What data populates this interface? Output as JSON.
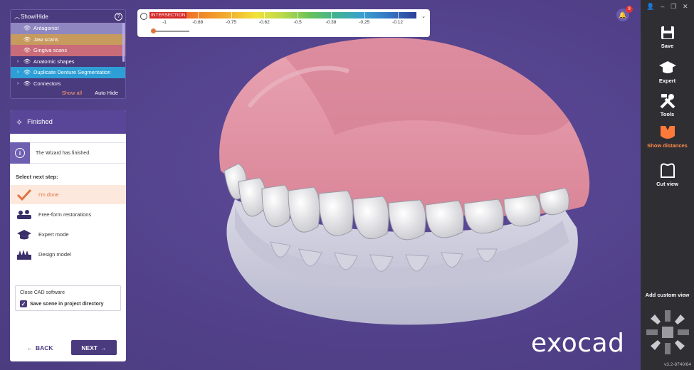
{
  "visibility": {
    "header": "Show/Hide",
    "rows": [
      {
        "name": "Antagonist",
        "color": "#8f87c0",
        "expandable": false
      },
      {
        "name": "Jaw scans",
        "color": "#c79a5e",
        "expandable": false
      },
      {
        "name": "Gingiva scans",
        "color": "#c96b78",
        "expandable": false
      },
      {
        "name": "Anatomic shapes",
        "color": "#4a3a7e",
        "expandable": true
      },
      {
        "name": "Duplicate Denture Segmentation",
        "color": "#2e9fd6",
        "expandable": true
      },
      {
        "name": "Connectors",
        "color": "#4a3a7e",
        "expandable": true
      }
    ],
    "show_all": "Show all",
    "auto_hide": "Auto Hide"
  },
  "wizard": {
    "title": "Finished",
    "message": "The Wizard has finished.",
    "next_step_label": "Select next step:",
    "options": [
      {
        "name": "I'm done",
        "selected": true
      },
      {
        "name": "Free-form restorations",
        "selected": false
      },
      {
        "name": "Expert mode",
        "selected": false
      },
      {
        "name": "Design model",
        "selected": false
      }
    ],
    "close_title": "Close CAD software",
    "save_scene": "Save scene in project directory",
    "back": "BACK",
    "next": "NEXT"
  },
  "scale": {
    "intersection": "INTERSECTION",
    "labels": [
      "-1",
      "-0.88",
      "-0.75",
      "-0.62",
      "-0.5",
      "-0.38",
      "-0.25",
      "-0.12"
    ]
  },
  "notification": {
    "count": "9"
  },
  "logo": "exocad",
  "toolbar": {
    "tools": [
      {
        "label": "Save",
        "icon": "save-icon"
      },
      {
        "label": "Expert",
        "icon": "graduation-cap-icon"
      },
      {
        "label": "Tools",
        "icon": "tools-icon"
      },
      {
        "label": "Show distances",
        "icon": "show-distances-icon"
      },
      {
        "label": "Cut view",
        "icon": "cut-view-icon"
      }
    ],
    "add_custom_view": "Add custom view",
    "version": "v3.2-8740/64"
  }
}
